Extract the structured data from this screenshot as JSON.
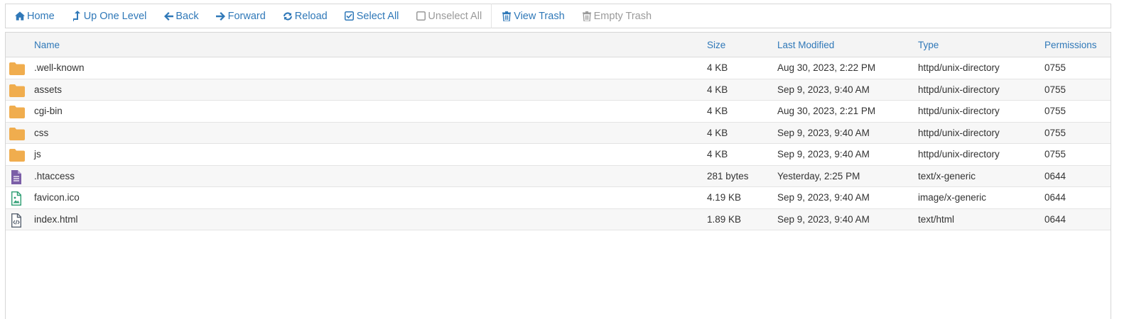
{
  "toolbar": {
    "home": "Home",
    "up": "Up One Level",
    "back": "Back",
    "forward": "Forward",
    "reload": "Reload",
    "select_all": "Select All",
    "unselect_all": "Unselect All",
    "view_trash": "View Trash",
    "empty_trash": "Empty Trash"
  },
  "columns": {
    "name": "Name",
    "size": "Size",
    "modified": "Last Modified",
    "type": "Type",
    "permissions": "Permissions"
  },
  "files": [
    {
      "icon": "folder-icon",
      "name": ".well-known",
      "size": "4 KB",
      "modified": "Aug 30, 2023, 2:22 PM",
      "type": "httpd/unix-directory",
      "permissions": "0755"
    },
    {
      "icon": "folder-icon",
      "name": "assets",
      "size": "4 KB",
      "modified": "Sep 9, 2023, 9:40 AM",
      "type": "httpd/unix-directory",
      "permissions": "0755"
    },
    {
      "icon": "folder-icon",
      "name": "cgi-bin",
      "size": "4 KB",
      "modified": "Aug 30, 2023, 2:21 PM",
      "type": "httpd/unix-directory",
      "permissions": "0755"
    },
    {
      "icon": "folder-icon",
      "name": "css",
      "size": "4 KB",
      "modified": "Sep 9, 2023, 9:40 AM",
      "type": "httpd/unix-directory",
      "permissions": "0755"
    },
    {
      "icon": "folder-icon",
      "name": "js",
      "size": "4 KB",
      "modified": "Sep 9, 2023, 9:40 AM",
      "type": "httpd/unix-directory",
      "permissions": "0755"
    },
    {
      "icon": "text-file-icon",
      "name": ".htaccess",
      "size": "281 bytes",
      "modified": "Yesterday, 2:25 PM",
      "type": "text/x-generic",
      "permissions": "0644"
    },
    {
      "icon": "image-file-icon",
      "name": "favicon.ico",
      "size": "4.19 KB",
      "modified": "Sep 9, 2023, 9:40 AM",
      "type": "image/x-generic",
      "permissions": "0644"
    },
    {
      "icon": "code-file-icon",
      "name": "index.html",
      "size": "1.89 KB",
      "modified": "Sep 9, 2023, 9:40 AM",
      "type": "text/html",
      "permissions": "0644"
    }
  ],
  "colors": {
    "link": "#2f78b8",
    "disabled": "#9a9a9a",
    "folder": "#f0ad4e",
    "text_file": "#7b5ea7",
    "image_file": "#2e9e73",
    "code_file": "#5a6472"
  }
}
